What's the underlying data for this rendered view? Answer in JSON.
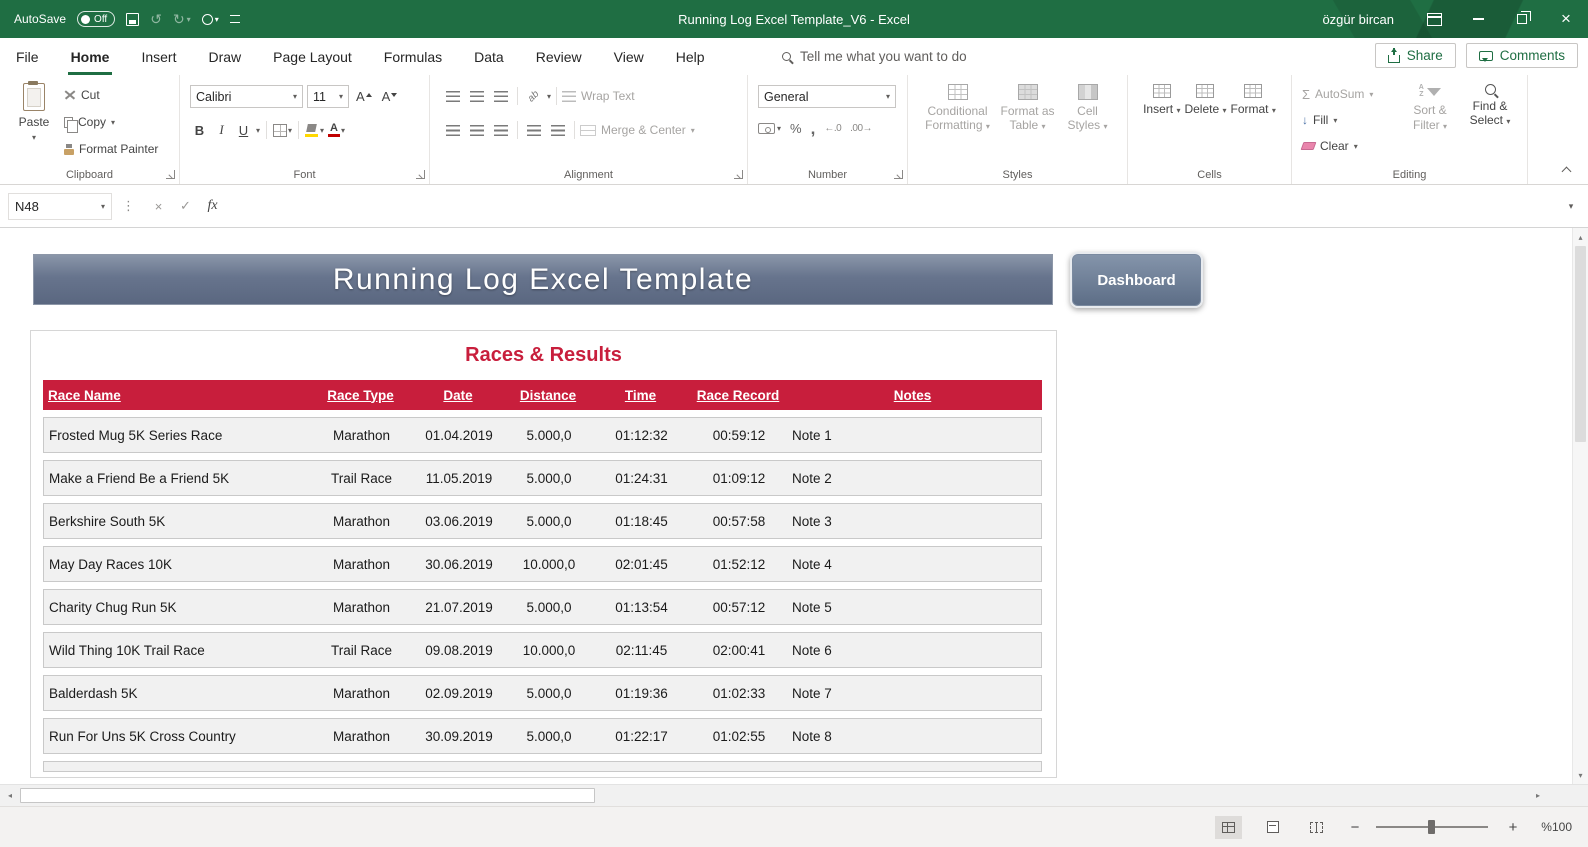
{
  "titlebar": {
    "autosave_label": "AutoSave",
    "autosave_state": "Off",
    "title": "Running Log Excel Template_V6  -  Excel",
    "user_name": "özgür bircan"
  },
  "tabs": [
    {
      "label": "File"
    },
    {
      "label": "Home"
    },
    {
      "label": "Insert"
    },
    {
      "label": "Draw"
    },
    {
      "label": "Page Layout"
    },
    {
      "label": "Formulas"
    },
    {
      "label": "Data"
    },
    {
      "label": "Review"
    },
    {
      "label": "View"
    },
    {
      "label": "Help"
    }
  ],
  "tell_me": "Tell me what you want to do",
  "share_label": "Share",
  "comments_label": "Comments",
  "ribbon": {
    "clipboard": {
      "group_label": "Clipboard",
      "paste": "Paste",
      "cut": "Cut",
      "copy": "Copy",
      "format_painter": "Format Painter"
    },
    "font": {
      "group_label": "Font",
      "font_name": "Calibri",
      "font_size": "11",
      "bold": "B",
      "italic": "I",
      "underline": "U"
    },
    "alignment": {
      "group_label": "Alignment",
      "wrap_text": "Wrap Text",
      "merge_center": "Merge & Center",
      "orientation": "ab"
    },
    "number": {
      "group_label": "Number",
      "number_format": "General",
      "percent": "%",
      "comma": ",",
      "increase_decimal": "←.0",
      "decrease_decimal": ".00→"
    },
    "styles": {
      "group_label": "Styles",
      "conditional_formatting": "Conditional Formatting",
      "format_as_table": "Format as Table",
      "cell_styles": "Cell Styles"
    },
    "cells": {
      "group_label": "Cells",
      "insert": "Insert",
      "delete": "Delete",
      "format": "Format"
    },
    "editing": {
      "group_label": "Editing",
      "autosum": "AutoSum",
      "fill": "Fill",
      "clear": "Clear",
      "sort_filter": "Sort & Filter",
      "find_select": "Find & Select"
    }
  },
  "formula_bar": {
    "name_box": "N48",
    "formula": ""
  },
  "sheet": {
    "banner_title": "Running Log Excel Template",
    "dashboard_button": "Dashboard",
    "section_title": "Races & Results",
    "table": {
      "headers": [
        "Race Name",
        "Race Type",
        "Date",
        "Distance",
        "Time",
        "Race Record",
        "Notes"
      ],
      "rows": [
        [
          "Frosted Mug 5K Series Race",
          "Marathon",
          "01.04.2019",
          "5.000,0",
          "01:12:32",
          "00:59:12",
          "Note 1"
        ],
        [
          "Make a Friend Be a Friend 5K",
          "Trail Race",
          "11.05.2019",
          "5.000,0",
          "01:24:31",
          "01:09:12",
          "Note 2"
        ],
        [
          "Berkshire South 5K",
          "Marathon",
          "03.06.2019",
          "5.000,0",
          "01:18:45",
          "00:57:58",
          "Note 3"
        ],
        [
          "May Day Races 10K",
          "Marathon",
          "30.06.2019",
          "10.000,0",
          "02:01:45",
          "01:52:12",
          "Note 4"
        ],
        [
          "Charity Chug Run 5K",
          "Marathon",
          "21.07.2019",
          "5.000,0",
          "01:13:54",
          "00:57:12",
          "Note 5"
        ],
        [
          "Wild Thing 10K Trail Race",
          "Trail Race",
          "09.08.2019",
          "10.000,0",
          "02:11:45",
          "02:00:41",
          "Note 6"
        ],
        [
          "Balderdash 5K",
          "Marathon",
          "02.09.2019",
          "5.000,0",
          "01:19:36",
          "01:02:33",
          "Note 7"
        ],
        [
          "Run For Uns 5K Cross Country",
          "Marathon",
          "30.09.2019",
          "5.000,0",
          "01:22:17",
          "01:02:55",
          "Note 8"
        ]
      ]
    }
  },
  "status_bar": {
    "zoom_level": "%100"
  },
  "colors": {
    "excel_green": "#1f6e43",
    "table_header_red": "#c81e3c",
    "banner_gradient_top": "#8a96a9",
    "banner_gradient_bottom": "#5a6780"
  }
}
